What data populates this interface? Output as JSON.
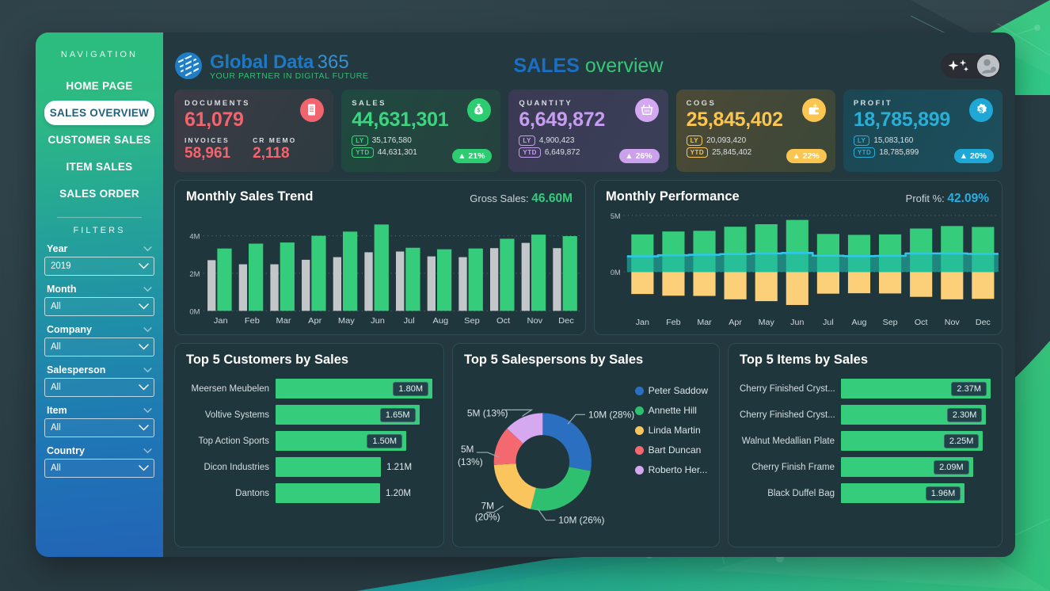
{
  "sidebar": {
    "nav_header": "NAVIGATION",
    "nav_items": [
      {
        "label": "HOME PAGE",
        "active": false
      },
      {
        "label": "SALES OVERVIEW",
        "active": true
      },
      {
        "label": "CUSTOMER SALES",
        "active": false
      },
      {
        "label": "ITEM SALES",
        "active": false
      },
      {
        "label": "SALES ORDER",
        "active": false
      }
    ],
    "filters_header": "FILTERS",
    "filters": [
      {
        "label": "Year",
        "value": "2019"
      },
      {
        "label": "Month",
        "value": "All"
      },
      {
        "label": "Company",
        "value": "All"
      },
      {
        "label": "Salesperson",
        "value": "All"
      },
      {
        "label": "Item",
        "value": "All"
      },
      {
        "label": "Country",
        "value": "All"
      }
    ]
  },
  "header": {
    "logo_name_bold": "Global Data",
    "logo_name_light": "365",
    "logo_tagline": "YOUR PARTNER IN DIGITAL FUTURE",
    "title_strong": "SALES",
    "title_light": "overview",
    "sparkle_icon": "sparkle-icon",
    "avatar_icon": "user-avatar-icon"
  },
  "kpis": [
    {
      "label": "DOCUMENTS",
      "value": "61,079",
      "icon": "receipt-icon",
      "accent": "#f2646e",
      "bg_from": "#3c3b46",
      "bg_to": "#2d3b40",
      "icon_bg": "#f2646e",
      "icon_fg": "#ffffff",
      "sub_cols": [
        {
          "label": "INVOICES",
          "value": "58,961"
        },
        {
          "label": "CR MEMO",
          "value": "2,118"
        }
      ]
    },
    {
      "label": "SALES",
      "value": "44,631,301",
      "icon": "money-bag-icon",
      "accent": "#3ad67f",
      "bg_from": "#1f4a3f",
      "bg_to": "#27413f",
      "icon_bg": "#2ecc71",
      "icon_fg": "#ffffff",
      "ly_label": "LY",
      "ly_value": "35,176,580",
      "ytd_label": "YTD",
      "ytd_value": "44,631,301",
      "delta": "▲ 21%",
      "delta_bg": "#2ecc71"
    },
    {
      "label": "QUANTITY",
      "value": "6,649,872",
      "icon": "basket-icon",
      "accent": "#c79df0",
      "bg_from": "#3b3a55",
      "bg_to": "#3a3f57",
      "icon_bg": "#d3a8f0",
      "icon_fg": "#ffffff",
      "ly_label": "LY",
      "ly_value": "4,900,423",
      "ytd_label": "YTD",
      "ytd_value": "6,649,872",
      "delta": "▲ 26%",
      "delta_bg": "#cba0ec"
    },
    {
      "label": "COGS",
      "value": "25,845,402",
      "icon": "wallet-icon",
      "accent": "#fbc552",
      "bg_from": "#4c4a36",
      "bg_to": "#3b4738",
      "icon_bg": "#fbc552",
      "icon_fg": "#ffffff",
      "ly_label": "LY",
      "ly_value": "20,093,420",
      "ytd_label": "YTD",
      "ytd_value": "25,845,402",
      "delta": "▲ 22%",
      "delta_bg": "#fbc552"
    },
    {
      "label": "PROFIT",
      "value": "18,785,899",
      "icon": "dollar-badge-icon",
      "accent": "#2aaed6",
      "bg_from": "#1b4754",
      "bg_to": "#1c4f5c",
      "icon_bg": "#1fa8d6",
      "icon_fg": "#ffffff",
      "ly_label": "LY",
      "ly_value": "15,083,160",
      "ytd_label": "YTD",
      "ytd_value": "18,785,899",
      "delta": "▲ 20%",
      "delta_bg": "#1fa8d6"
    }
  ],
  "cards": {
    "sales_trend_title": "Monthly Sales Trend",
    "sales_trend_kpi_label": "Gross Sales:",
    "sales_trend_kpi_value": "46.60M",
    "performance_title": "Monthly Performance",
    "performance_kpi_label": "Profit %:",
    "performance_kpi_value": "42.09%",
    "customers_title": "Top 5 Customers by Sales",
    "salespersons_title": "Top 5 Salespersons by Sales",
    "items_title": "Top 5 Items by Sales"
  },
  "chart_data": [
    {
      "type": "bar",
      "name": "monthly-sales-trend",
      "title": "Monthly Sales Trend",
      "categories": [
        "Jan",
        "Feb",
        "Mar",
        "Apr",
        "May",
        "Jun",
        "Jul",
        "Aug",
        "Sep",
        "Oct",
        "Nov",
        "Dec"
      ],
      "series": [
        {
          "name": "Last Year",
          "color": "#c4c7ca",
          "values": [
            2.7,
            2.48,
            2.48,
            2.72,
            2.86,
            3.12,
            3.16,
            2.9,
            2.86,
            3.34,
            3.62,
            3.34
          ]
        },
        {
          "name": "This Year",
          "color": "#35cc7c",
          "values": [
            3.32,
            3.58,
            3.64,
            4.0,
            4.22,
            4.6,
            3.36,
            3.28,
            3.32,
            3.84,
            4.06,
            3.98
          ]
        }
      ],
      "ylabel": "",
      "xlabel": "",
      "ylim": [
        0,
        5
      ],
      "yticks": [
        0,
        2,
        4
      ],
      "ytick_labels": [
        "0M",
        "2M",
        "4M"
      ],
      "grid": true,
      "annotation": "Gross Sales: 46.60M"
    },
    {
      "type": "bar",
      "name": "monthly-performance",
      "title": "Monthly Performance",
      "categories": [
        "Jan",
        "Feb",
        "Mar",
        "Apr",
        "May",
        "Jun",
        "Jul",
        "Aug",
        "Sep",
        "Oct",
        "Nov",
        "Dec"
      ],
      "series": [
        {
          "name": "Sales",
          "color": "#35cc7c",
          "values": [
            3.32,
            3.58,
            3.64,
            4.0,
            4.22,
            4.6,
            3.36,
            3.28,
            3.32,
            3.84,
            4.06,
            3.98
          ]
        },
        {
          "name": "COGS",
          "color": "#fbd079",
          "values": [
            -1.95,
            -2.1,
            -2.12,
            -2.42,
            -2.58,
            -2.92,
            -1.92,
            -1.88,
            -1.9,
            -2.2,
            -2.42,
            -2.38
          ]
        },
        {
          "name": "Profit",
          "color": "#2ec7e8",
          "type": "line",
          "values": [
            1.38,
            1.48,
            1.52,
            1.58,
            1.64,
            1.68,
            1.44,
            1.4,
            1.42,
            1.64,
            1.64,
            1.6
          ]
        }
      ],
      "ylim": [
        -3.3,
        5
      ],
      "yticks": [
        0,
        5
      ],
      "ytick_labels": [
        "0M",
        "5M"
      ],
      "grid": true,
      "annotation": "Profit %: 42.09%"
    },
    {
      "type": "bar",
      "name": "top-5-customers-by-sales",
      "title": "Top 5 Customers by Sales",
      "orientation": "horizontal",
      "categories": [
        "Meersen Meubelen",
        "Voltive Systems",
        "Top Action Sports",
        "Dicon Industries",
        "Dantons"
      ],
      "values": [
        1.8,
        1.65,
        1.5,
        1.21,
        1.2
      ],
      "labels": [
        "1.80M",
        "1.65M",
        "1.50M",
        "1.21M",
        "1.20M"
      ],
      "label_inside": [
        true,
        true,
        true,
        false,
        false
      ],
      "color": "#35cc7c",
      "xlim": [
        0,
        1.8
      ]
    },
    {
      "type": "pie",
      "name": "top-5-salespersons-by-sales",
      "title": "Top 5 Salespersons by Sales",
      "donut": true,
      "slices": [
        {
          "label": "Peter Saddow",
          "value": 10,
          "pct": 28,
          "color": "#2a6fc0",
          "callout": "10M (28%)"
        },
        {
          "label": "Annette Hill",
          "value": 10,
          "pct": 26,
          "color": "#2ec06e",
          "callout": "10M (26%)"
        },
        {
          "label": "Linda Martin",
          "value": 7,
          "pct": 20,
          "color": "#fbc55e",
          "callout": "7M\n(20%)"
        },
        {
          "label": "Bart Duncan",
          "value": 5,
          "pct": 13,
          "color": "#f4696f",
          "callout": "5M\n(13%)"
        },
        {
          "label": "Roberto Her...",
          "value": 5,
          "pct": 13,
          "color": "#d5a8ef",
          "callout": "5M (13%)"
        }
      ],
      "legend_position": "right"
    },
    {
      "type": "bar",
      "name": "top-5-items-by-sales",
      "title": "Top 5 Items by Sales",
      "orientation": "horizontal",
      "categories": [
        "Cherry Finished Cryst...",
        "Cherry Finished Cryst...",
        "Walnut Medallian Plate",
        "Cherry Finish Frame",
        "Black Duffel Bag"
      ],
      "values": [
        2.37,
        2.3,
        2.25,
        2.09,
        1.96
      ],
      "labels": [
        "2.37M",
        "2.30M",
        "2.25M",
        "2.09M",
        "1.96M"
      ],
      "label_inside": [
        true,
        true,
        true,
        true,
        true
      ],
      "color": "#35cc7c",
      "xlim": [
        0,
        2.37
      ]
    }
  ],
  "donut_callouts": {
    "top_left": "5M (13%)",
    "left": "5M\n(13%)",
    "top_right": "10M (28%)",
    "bottom_left": "7M\n(20%)",
    "bottom_right": "10M (26%)"
  }
}
